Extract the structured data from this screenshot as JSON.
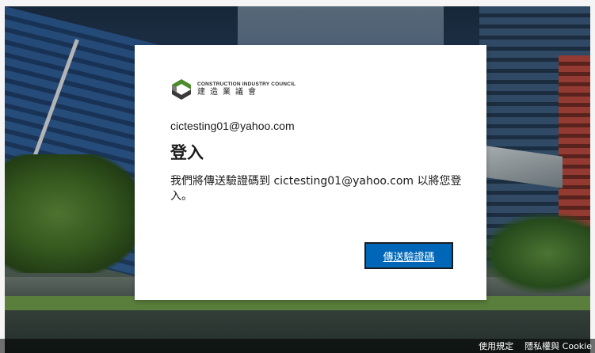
{
  "brand": {
    "name_en": "CONSTRUCTION INDUSTRY COUNCIL",
    "name_zh": "建造業議會",
    "logo_icon": "cic-logo-icon",
    "color_green": "#4a8b2c",
    "color_dark": "#3a3a3a"
  },
  "signin": {
    "email": "cictesting01@yahoo.com",
    "title": "登入",
    "message": "我們將傳送驗證碼到 cictesting01@yahoo.com 以將您登入。",
    "send_code_label": "傳送驗證碼"
  },
  "footer": {
    "terms_label": "使用規定",
    "privacy_label": "隱私權與 Cookie"
  },
  "colors": {
    "primary_button": "#0067b8"
  }
}
